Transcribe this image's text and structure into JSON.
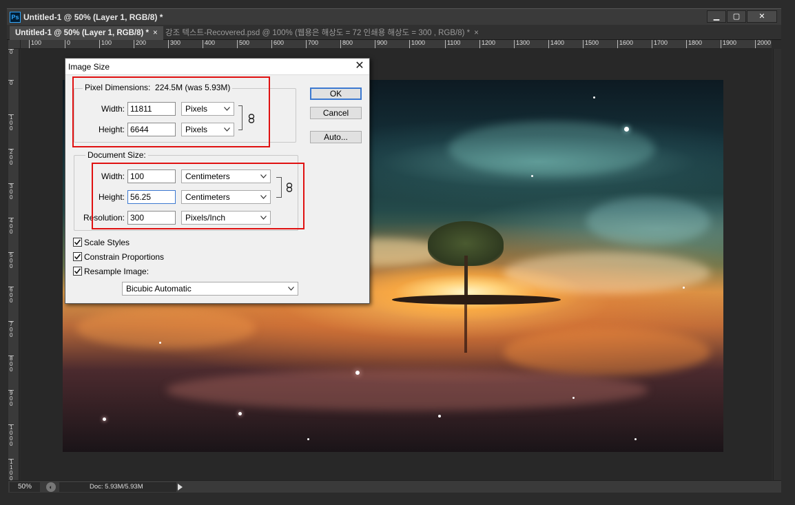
{
  "window": {
    "app_icon": "Ps",
    "title": "Untitled-1 @ 50% (Layer 1, RGB/8) *",
    "minimize": "▁",
    "maximize": "▢",
    "close": "✕"
  },
  "tabs": [
    {
      "label": "Untitled-1 @ 50% (Layer 1, RGB/8) *",
      "close": "×",
      "active": true
    },
    {
      "label": "강조 텍스트-Recovered.psd @ 100% (웹용은 해상도 = 72 인쇄용 해상도 = 300 , RGB/8) *",
      "close": "×",
      "active": false
    }
  ],
  "ruler": {
    "horizontal": [
      "100",
      "0",
      "100",
      "200",
      "300",
      "400",
      "500",
      "600",
      "700",
      "800",
      "900",
      "1000",
      "1100",
      "1200",
      "1300",
      "1400",
      "1500",
      "1600",
      "1700",
      "1800",
      "1900",
      "2000"
    ],
    "vertical": [
      "0",
      "0",
      "100",
      "200",
      "300",
      "400",
      "500",
      "600",
      "700",
      "800",
      "900",
      "1000",
      "1100"
    ]
  },
  "status": {
    "zoom": "50%",
    "doc": "Doc: 5.93M/5.93M"
  },
  "dialog": {
    "title": "Image Size",
    "close": "✕",
    "pixel_dimensions": {
      "legend": "Pixel Dimensions:",
      "size": "224.5M (was 5.93M)",
      "width_label": "Width:",
      "width_value": "11811",
      "width_unit": "Pixels",
      "height_label": "Height:",
      "height_value": "6644",
      "height_unit": "Pixels"
    },
    "document_size": {
      "legend": "Document Size:",
      "width_label": "Width:",
      "width_value": "100",
      "width_unit": "Centimeters",
      "height_label": "Height:",
      "height_value": "56.25",
      "height_unit": "Centimeters",
      "resolution_label": "Resolution:",
      "resolution_value": "300",
      "resolution_unit": "Pixels/Inch"
    },
    "buttons": {
      "ok": "OK",
      "cancel": "Cancel",
      "auto": "Auto..."
    },
    "options": {
      "scale_styles": {
        "label": "Scale Styles",
        "checked": true
      },
      "constrain_proportions": {
        "label": "Constrain Proportions",
        "checked": true
      },
      "resample_image": {
        "label": "Resample Image:",
        "checked": true
      }
    },
    "resample_method": "Bicubic Automatic"
  },
  "colors": {
    "highlight_box": "#e01010",
    "focus_border": "#3b78d0"
  }
}
